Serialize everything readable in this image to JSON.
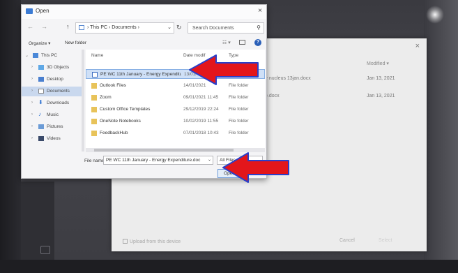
{
  "open_dialog": {
    "title": "Open",
    "close_glyph": "×",
    "nav": {
      "back": "←",
      "forward": "→",
      "up": "↑"
    },
    "breadcrumb": "› This PC › Documents ›",
    "refresh_glyph": "↻",
    "search_placeholder": "Search Documents",
    "toolbar": {
      "organize": "Organize ▾",
      "new_folder": "New folder",
      "help": "?"
    },
    "nav_items": [
      {
        "label": "This PC"
      },
      {
        "label": "3D Objects"
      },
      {
        "label": "Desktop"
      },
      {
        "label": "Documents"
      },
      {
        "label": "Downloads"
      },
      {
        "label": "Music"
      },
      {
        "label": "Pictures"
      },
      {
        "label": "Videos"
      }
    ],
    "columns": {
      "name": "Name",
      "date": "Date modif",
      "type": "Type"
    },
    "files": [
      {
        "name": "PE WC 11th January - Energy Expenditure...",
        "date": "13/01/",
        "type": "",
        "kind": "doc",
        "selected": true
      },
      {
        "name": "Outlook Files",
        "date": "14/01/2021",
        "type": "File folder",
        "kind": "folder",
        "selected": false
      },
      {
        "name": "Zoom",
        "date": "09/01/2021 11:45",
        "type": "File folder",
        "kind": "folder",
        "selected": false
      },
      {
        "name": "Custom Office Templates",
        "date": "29/12/2019 22:24",
        "type": "File folder",
        "kind": "folder",
        "selected": false
      },
      {
        "name": "OneNote Notebooks",
        "date": "10/02/2019 11:55",
        "type": "File folder",
        "kind": "folder",
        "selected": false
      },
      {
        "name": "FeedbackHub",
        "date": "07/01/2018 10:43",
        "type": "File folder",
        "kind": "folder",
        "selected": false
      }
    ],
    "file_name_label": "File name:",
    "file_name_value": "PE WC 11th January - Energy Expenditure.doc",
    "filter_value": "All Files (*.*)",
    "open_button": "Open"
  },
  "upload_dialog": {
    "close_glyph": "×",
    "modified_header": "Modified ▾",
    "rows": [
      {
        "name": "e nucleus 13jan.docx",
        "date": "Jan 13, 2021"
      },
      {
        "name": "e.docx",
        "date": "Jan 13, 2021"
      }
    ],
    "upload_from_device": "Upload from this device",
    "cancel": "Cancel",
    "select": "Select"
  },
  "colors": {
    "arrow_fill": "#e3161b",
    "arrow_outline": "#2a3fc9",
    "selection": "#cfe0f7",
    "accent": "#2a5fb8"
  }
}
